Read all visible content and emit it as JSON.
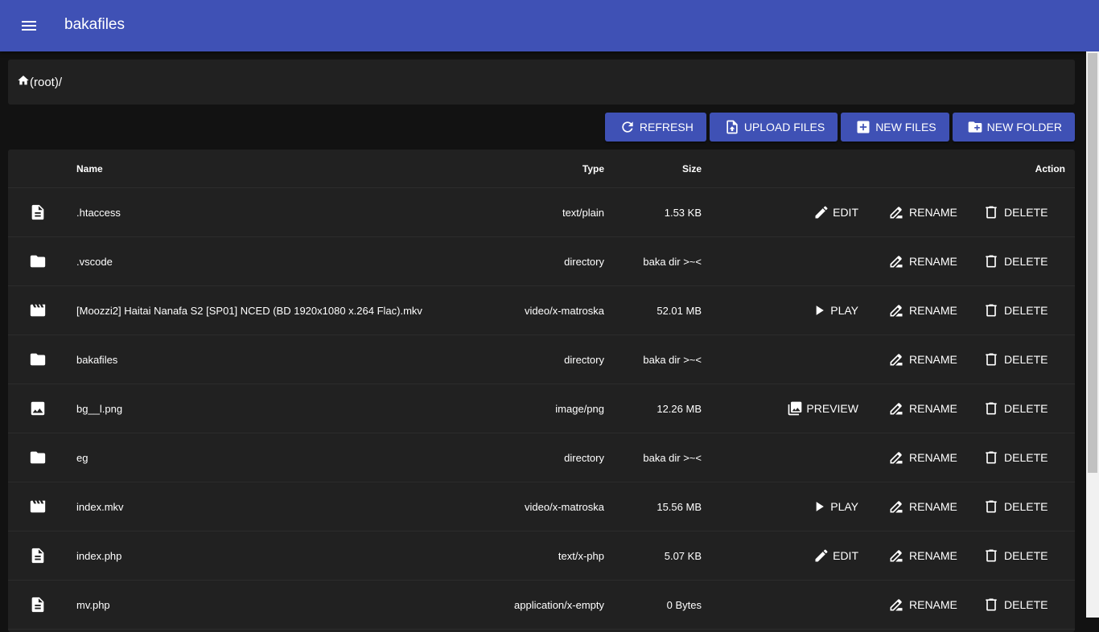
{
  "app": {
    "title": "bakafiles",
    "menu_icon": "menu-icon"
  },
  "breadcrumb": {
    "path": "(root)/"
  },
  "toolbar": {
    "refresh": "REFRESH",
    "upload": "UPLOAD FILES",
    "new_files": "NEW FILES",
    "new_folder": "NEW FOLDER"
  },
  "table": {
    "headers": {
      "name": "Name",
      "type": "Type",
      "size": "Size",
      "action": "Action"
    },
    "rename_label": "RENAME",
    "delete_label": "DELETE",
    "rows": [
      {
        "icon": "file",
        "name": ".htaccess",
        "type": "text/plain",
        "size": "1.53 KB",
        "action": "EDIT"
      },
      {
        "icon": "folder",
        "name": ".vscode",
        "type": "directory",
        "size": "baka dir >~<",
        "action": ""
      },
      {
        "icon": "movie",
        "name": "[Moozzi2] Haitai Nanafa S2 [SP01] NCED (BD 1920x1080 x.264 Flac).mkv",
        "type": "video/x-matroska",
        "size": "52.01 MB",
        "action": "PLAY"
      },
      {
        "icon": "folder",
        "name": "bakafiles",
        "type": "directory",
        "size": "baka dir >~<",
        "action": ""
      },
      {
        "icon": "image",
        "name": "bg__l.png",
        "type": "image/png",
        "size": "12.26 MB",
        "action": "PREVIEW"
      },
      {
        "icon": "folder",
        "name": "eg",
        "type": "directory",
        "size": "baka dir >~<",
        "action": ""
      },
      {
        "icon": "movie",
        "name": "index.mkv",
        "type": "video/x-matroska",
        "size": "15.56 MB",
        "action": "PLAY"
      },
      {
        "icon": "file",
        "name": "index.php",
        "type": "text/x-php",
        "size": "5.07 KB",
        "action": "EDIT"
      },
      {
        "icon": "file",
        "name": "mv.php",
        "type": "application/x-empty",
        "size": "0 Bytes",
        "action": ""
      }
    ]
  },
  "colors": {
    "primary": "#3f51b5",
    "surface": "#212121",
    "background": "#121212"
  }
}
